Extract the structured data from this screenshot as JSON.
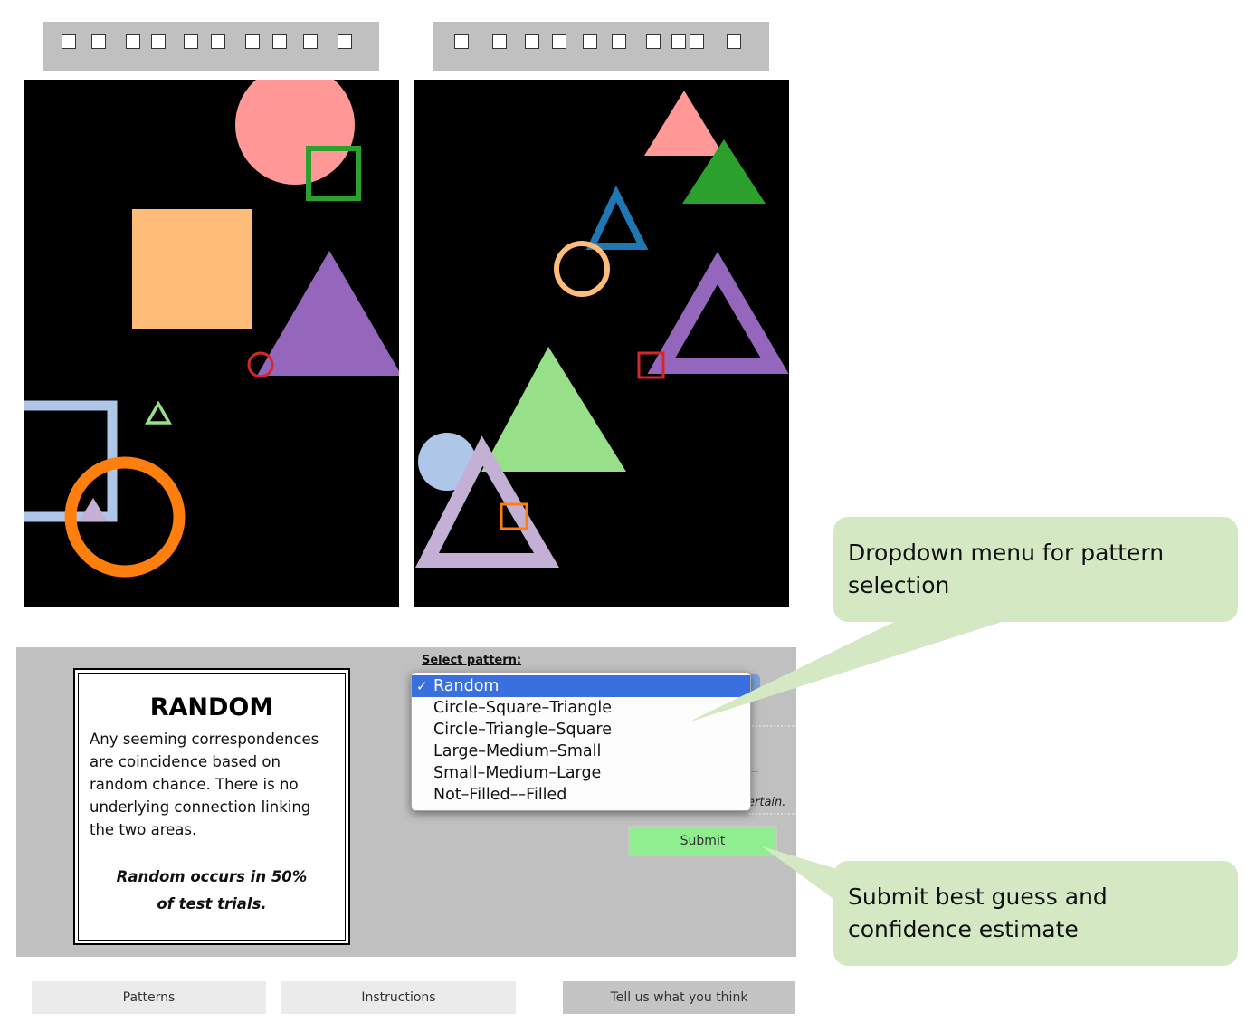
{
  "top_strip_left": {
    "checkbox_count": 10
  },
  "top_strip_right": {
    "checkbox_count": 10
  },
  "panels": {
    "left_shapes": [
      "pink-circle",
      "green-square-outline",
      "orange-square",
      "purple-triangle",
      "red-circle-outline",
      "light-blue-square-outline",
      "light-green-triangle-outline",
      "orange-circle-outline"
    ],
    "right_shapes": [
      "pink-triangle",
      "green-triangle",
      "blue-triangle-outline",
      "orange-circle-outline",
      "purple-triangle-outline",
      "red-square-outline",
      "green-triangle",
      "light-blue-circle",
      "lavender-triangle-outline",
      "orange-square-outline"
    ]
  },
  "pattern_card": {
    "title": "RANDOM",
    "body_lines": [
      "Any seeming correspondences",
      "are coincidence based on",
      "random chance. There is no",
      "underlying connection linking",
      "the two areas."
    ],
    "footnote_line1": "Random occurs in 50%",
    "footnote_line2": "of test trials."
  },
  "select": {
    "label": "Select pattern:",
    "selected_check": "✓",
    "options": [
      "Random",
      "Circle–Square–Triangle",
      "Circle–Triangle–Square",
      "Large–Medium–Small",
      "Small–Medium–Large",
      "Not–Filled––Filled"
    ],
    "selected_index": 0
  },
  "confidence": {
    "partial_text": "ertain."
  },
  "submit_label": "Submit",
  "nav": {
    "patterns": "Patterns",
    "instructions": "Instructions",
    "feedback": "Tell us what you think"
  },
  "callouts": {
    "dropdown": "Dropdown menu for pattern selection",
    "submit": "Submit best guess and confidence estimate"
  },
  "colors": {
    "strip": "#c0c0c0",
    "panel": "#000000",
    "callout": "#d5e8c4",
    "submit": "#90ee90",
    "selected": "#3a6fe0"
  }
}
